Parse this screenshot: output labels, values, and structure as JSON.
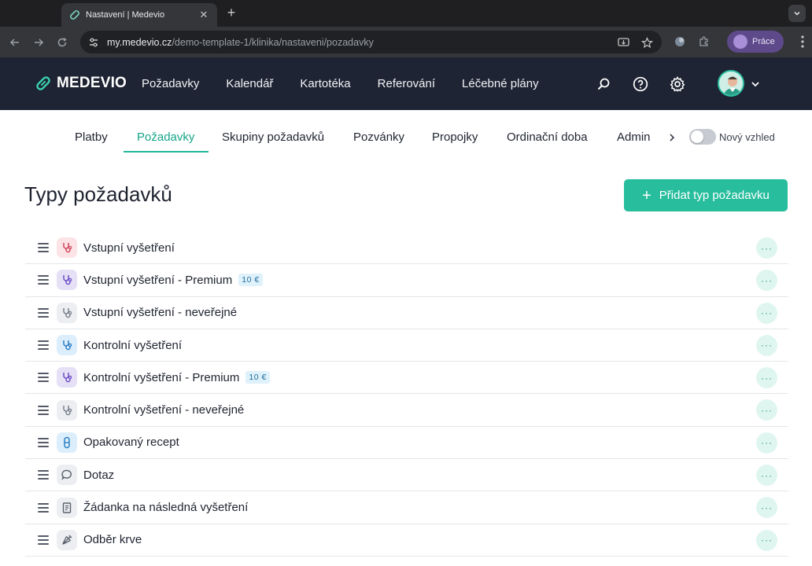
{
  "browser": {
    "tab_title": "Nastavení | Medevio",
    "url_host": "my.medevio.cz",
    "url_path": "/demo-template-1/klinika/nastaveni/pozadavky",
    "profile_label": "Práce"
  },
  "app": {
    "logo_text": "MEDEVIO",
    "main_nav": [
      "Požadavky",
      "Kalendář",
      "Kartotéka",
      "Referování",
      "Léčebné plány"
    ]
  },
  "subnav": {
    "items": [
      "Platby",
      "Požadavky",
      "Skupiny požadavků",
      "Pozvánky",
      "Propojky",
      "Ordinační doba",
      "Admin"
    ],
    "active": "Požadavky",
    "toggle_label": "Nový vzhled",
    "toggle_on": false
  },
  "page": {
    "title": "Typy požadavků",
    "add_button_label": "Přidat typ požadavku"
  },
  "request_types": [
    {
      "name": "Vstupní vyšetření",
      "icon": "stethoscope-icon",
      "icon_bg": "#fbe3e6",
      "icon_color": "#d0485c",
      "badge": ""
    },
    {
      "name": "Vstupní vyšetření - Premium",
      "icon": "stethoscope-icon",
      "icon_bg": "#e6e0f7",
      "icon_color": "#6b4fc4",
      "badge": "10 €"
    },
    {
      "name": "Vstupní vyšetření - neveřejné",
      "icon": "stethoscope-icon",
      "icon_bg": "#eceef1",
      "icon_color": "#7a808c",
      "badge": ""
    },
    {
      "name": "Kontrolní vyšetření",
      "icon": "stethoscope-icon",
      "icon_bg": "#dceefc",
      "icon_color": "#2b7fc2",
      "badge": ""
    },
    {
      "name": "Kontrolní vyšetření - Premium",
      "icon": "stethoscope-icon",
      "icon_bg": "#e6e0f7",
      "icon_color": "#6b4fc4",
      "badge": "10 €"
    },
    {
      "name": "Kontrolní vyšetření - neveřejné",
      "icon": "stethoscope-icon",
      "icon_bg": "#eceef1",
      "icon_color": "#7a808c",
      "badge": ""
    },
    {
      "name": "Opakovaný recept",
      "icon": "pill-icon",
      "icon_bg": "#dceefc",
      "icon_color": "#2b7fc2",
      "badge": ""
    },
    {
      "name": "Dotaz",
      "icon": "chat-bubble-icon",
      "icon_bg": "#eceef1",
      "icon_color": "#5a606c",
      "badge": ""
    },
    {
      "name": "Žádanka na následná vyšetření",
      "icon": "document-icon",
      "icon_bg": "#eceef1",
      "icon_color": "#5a606c",
      "badge": ""
    },
    {
      "name": "Odběr krve",
      "icon": "syringe-icon",
      "icon_bg": "#eceef1",
      "icon_color": "#5a606c",
      "badge": ""
    }
  ]
}
